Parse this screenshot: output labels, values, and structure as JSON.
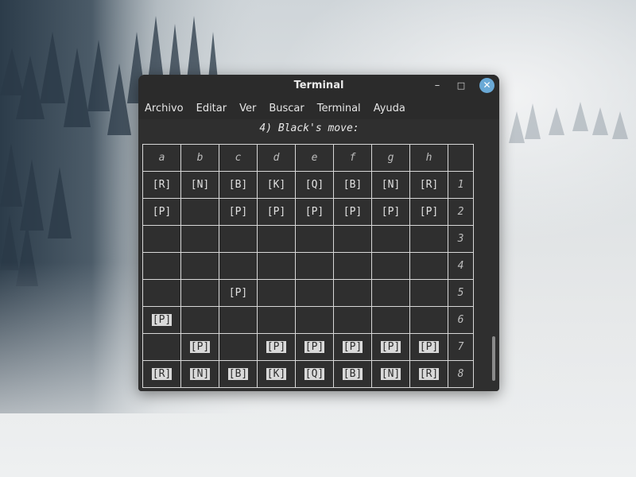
{
  "window": {
    "title": "Terminal",
    "minimize_symbol": "–",
    "maximize_symbol": "□",
    "close_symbol": "✕"
  },
  "menu": [
    "Archivo",
    "Editar",
    "Ver",
    "Buscar",
    "Terminal",
    "Ayuda"
  ],
  "terminal": {
    "prompt": "4) Black's move:"
  },
  "board": {
    "files": [
      "a",
      "b",
      "c",
      "d",
      "e",
      "f",
      "g",
      "h"
    ],
    "rows": [
      {
        "rank": "1",
        "cells": [
          {
            "text": "[R]",
            "side": "black"
          },
          {
            "text": "[N]",
            "side": "black"
          },
          {
            "text": "[B]",
            "side": "black"
          },
          {
            "text": "[K]",
            "side": "black"
          },
          {
            "text": "[Q]",
            "side": "black"
          },
          {
            "text": "[B]",
            "side": "black"
          },
          {
            "text": "[N]",
            "side": "black"
          },
          {
            "text": "[R]",
            "side": "black"
          }
        ]
      },
      {
        "rank": "2",
        "cells": [
          {
            "text": "[P]",
            "side": "black"
          },
          {
            "text": "",
            "side": ""
          },
          {
            "text": "[P]",
            "side": "black"
          },
          {
            "text": "[P]",
            "side": "black"
          },
          {
            "text": "[P]",
            "side": "black"
          },
          {
            "text": "[P]",
            "side": "black"
          },
          {
            "text": "[P]",
            "side": "black"
          },
          {
            "text": "[P]",
            "side": "black"
          }
        ]
      },
      {
        "rank": "3",
        "cells": [
          {
            "text": "",
            "side": ""
          },
          {
            "text": "",
            "side": ""
          },
          {
            "text": "",
            "side": ""
          },
          {
            "text": "",
            "side": ""
          },
          {
            "text": "",
            "side": ""
          },
          {
            "text": "",
            "side": ""
          },
          {
            "text": "",
            "side": ""
          },
          {
            "text": "",
            "side": ""
          }
        ]
      },
      {
        "rank": "4",
        "cells": [
          {
            "text": "",
            "side": ""
          },
          {
            "text": "",
            "side": ""
          },
          {
            "text": "",
            "side": ""
          },
          {
            "text": "",
            "side": ""
          },
          {
            "text": "",
            "side": ""
          },
          {
            "text": "",
            "side": ""
          },
          {
            "text": "",
            "side": ""
          },
          {
            "text": "",
            "side": ""
          }
        ]
      },
      {
        "rank": "5",
        "cells": [
          {
            "text": "",
            "side": ""
          },
          {
            "text": "",
            "side": ""
          },
          {
            "text": "[P]",
            "side": "black"
          },
          {
            "text": "",
            "side": ""
          },
          {
            "text": "",
            "side": ""
          },
          {
            "text": "",
            "side": ""
          },
          {
            "text": "",
            "side": ""
          },
          {
            "text": "",
            "side": ""
          }
        ]
      },
      {
        "rank": "6",
        "cells": [
          {
            "text": "[P]",
            "side": "white"
          },
          {
            "text": "",
            "side": ""
          },
          {
            "text": "",
            "side": ""
          },
          {
            "text": "",
            "side": ""
          },
          {
            "text": "",
            "side": ""
          },
          {
            "text": "",
            "side": ""
          },
          {
            "text": "",
            "side": ""
          },
          {
            "text": "",
            "side": ""
          }
        ]
      },
      {
        "rank": "7",
        "cells": [
          {
            "text": "",
            "side": ""
          },
          {
            "text": "[P]",
            "side": "white"
          },
          {
            "text": "",
            "side": ""
          },
          {
            "text": "[P]",
            "side": "white"
          },
          {
            "text": "[P]",
            "side": "white"
          },
          {
            "text": "[P]",
            "side": "white"
          },
          {
            "text": "[P]",
            "side": "white"
          },
          {
            "text": "[P]",
            "side": "white"
          }
        ]
      },
      {
        "rank": "8",
        "cells": [
          {
            "text": "[R]",
            "side": "white"
          },
          {
            "text": "[N]",
            "side": "white"
          },
          {
            "text": "[B]",
            "side": "white"
          },
          {
            "text": "[K]",
            "side": "white"
          },
          {
            "text": "[Q]",
            "side": "white"
          },
          {
            "text": "[B]",
            "side": "white"
          },
          {
            "text": "[N]",
            "side": "white"
          },
          {
            "text": "[R]",
            "side": "white"
          }
        ]
      }
    ]
  },
  "colors": {
    "window_bg": "#2f2f2f",
    "close_button": "#6aa9d6",
    "white_piece_bg": "#d9d9d9",
    "grid_line": "#d8d8d8"
  }
}
